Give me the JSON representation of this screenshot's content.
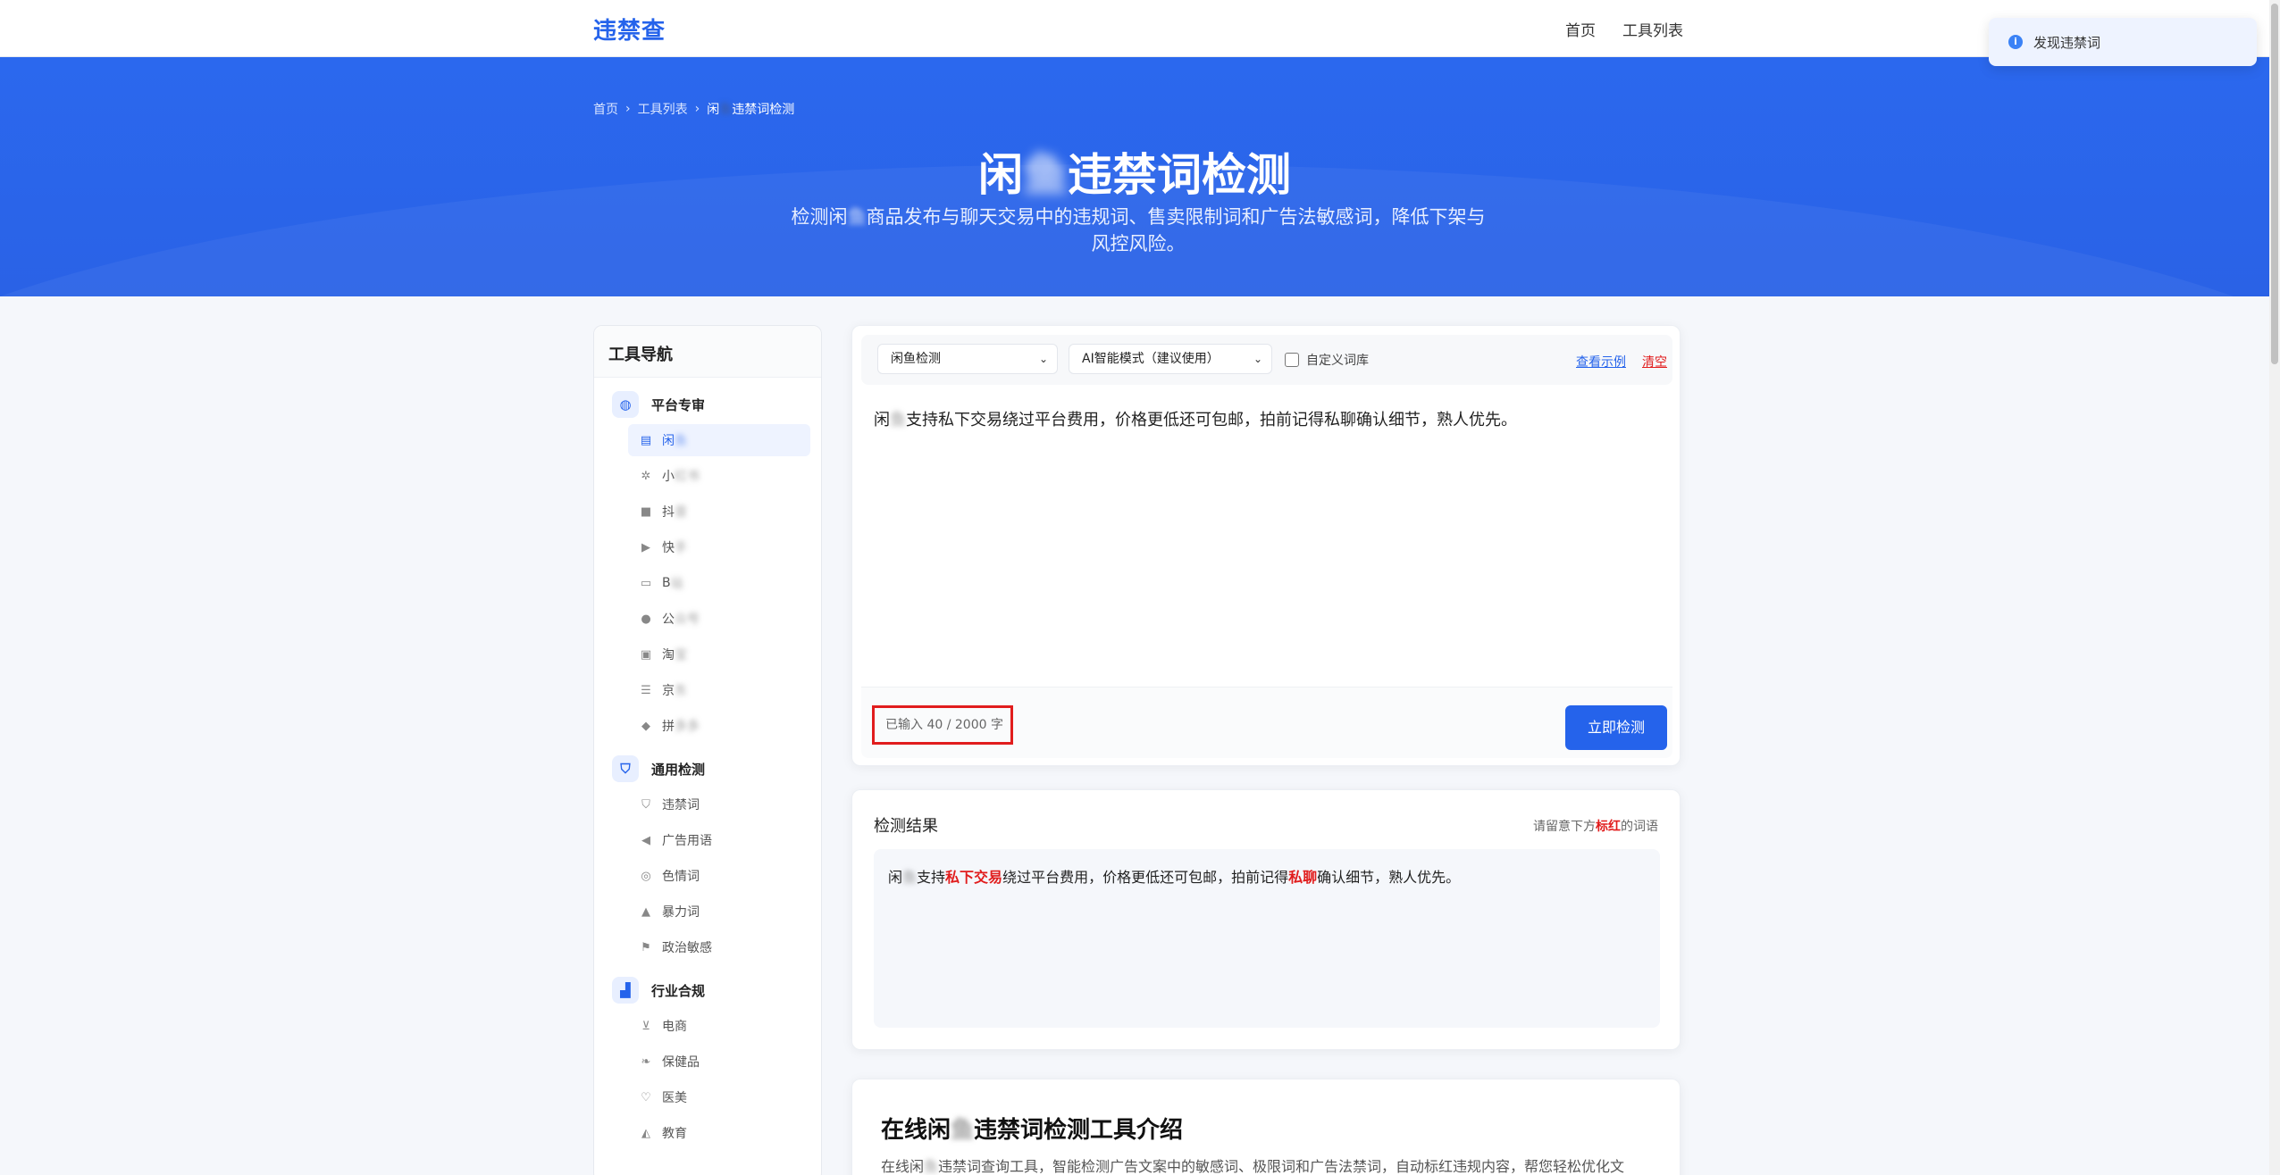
{
  "nav": {
    "logo": "违禁查",
    "home": "首页",
    "tools": "工具列表"
  },
  "toast": {
    "text": "发现违禁词"
  },
  "breadcrumb": {
    "home": "首页",
    "tools": "工具列表",
    "current_a": "闲",
    "current_blur": "鱼",
    "current_b": "违禁词检测"
  },
  "hero": {
    "title_a": "闲",
    "title_blur": "鱼",
    "title_b": "违禁词检测",
    "sub_a": "检测闲",
    "sub_blur": "鱼",
    "sub_b": "商品发布与聊天交易中的违规词、售卖限制词和广告法敏感词，降低下架与风控风险。"
  },
  "sidebar": {
    "title": "工具导航",
    "groups": [
      {
        "title": "平台专审",
        "items": [
          {
            "a": "闲",
            "blur": "鱼"
          },
          {
            "a": "小",
            "blur": "红书"
          },
          {
            "a": "抖",
            "blur": "音"
          },
          {
            "a": "快",
            "blur": "手"
          },
          {
            "a": "B",
            "blur": "站"
          },
          {
            "a": "公",
            "blur": "众号"
          },
          {
            "a": "淘",
            "blur": "宝"
          },
          {
            "a": "京",
            "blur": "东"
          },
          {
            "a": "拼",
            "blur": "多多"
          }
        ]
      },
      {
        "title": "通用检测",
        "items": [
          "违禁词",
          "广告用语",
          "色情词",
          "暴力词",
          "政治敏感"
        ]
      },
      {
        "title": "行业合规",
        "items": [
          "电商",
          "保健品",
          "医美",
          "教育"
        ]
      }
    ]
  },
  "editor": {
    "platform_select": "闲鱼检测",
    "mode_select": "AI智能模式（建议使用）",
    "custom_lexicon": "自定义词库",
    "example_link": "查看示例",
    "clear_link": "清空",
    "text_a": "闲",
    "text_blur": "鱼",
    "text_b": "支持私下交易绕过平台费用，价格更低还可包邮，拍前记得私聊确认细节，熟人优先。",
    "counter": "已输入 40 / 2000 字",
    "detect_button": "立即检测"
  },
  "result": {
    "title": "检测结果",
    "hint_a": "请留意下方",
    "hint_red": "标红",
    "hint_b": "的词语",
    "seg1": "闲",
    "seg1_blur": "鱼",
    "seg2": "支持",
    "hl1": "私下交易",
    "seg3": "绕过平台费用，价格更低还可包邮，拍前记得",
    "hl2": "私聊",
    "seg4": "确认细节，熟人优先。"
  },
  "intro": {
    "title_a": "在线闲",
    "title_blur": "鱼",
    "title_b": "违禁词检测工具介绍",
    "text_a": "在线闲",
    "text_blur": "鱼",
    "text_b": "违禁词查询工具，智能检测广告文案中的敏感词、极限词和广告法禁词，自动标红违规内容，帮您轻松优化文"
  },
  "colors": {
    "brand": "#2563eb",
    "danger": "#e11d1d"
  }
}
